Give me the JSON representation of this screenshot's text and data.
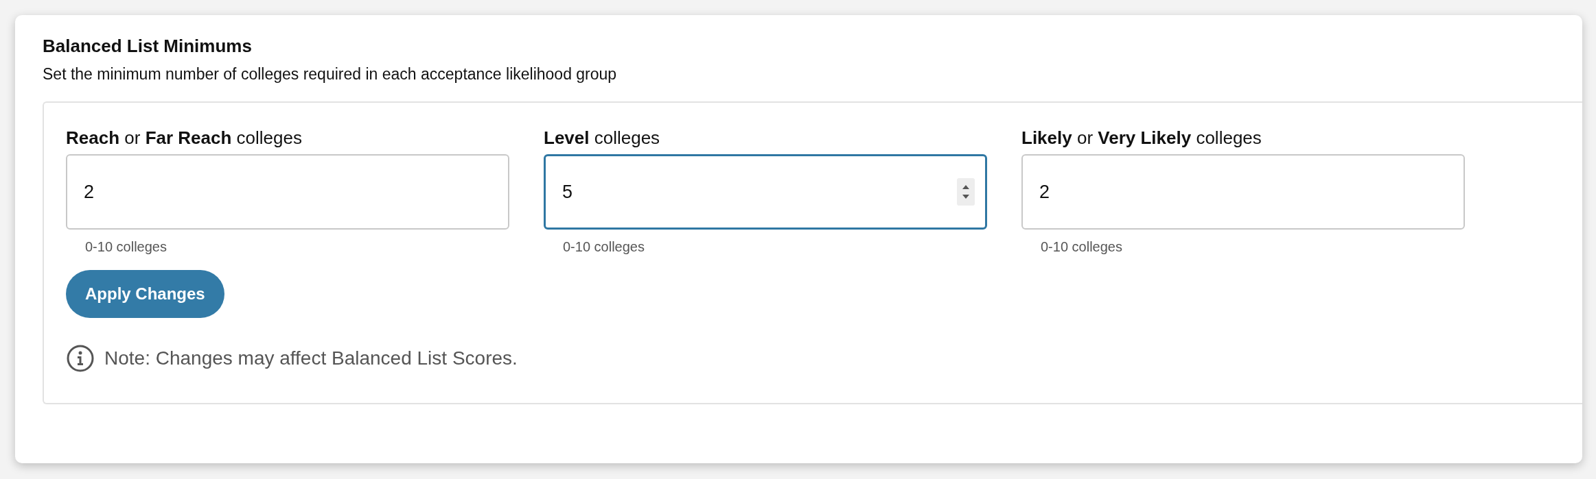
{
  "panel": {
    "title": "Balanced List Minimums",
    "description": "Set the minimum number of colleges required in each acceptance likelihood group",
    "fields": [
      {
        "label": "**Reach** or **Far Reach** colleges",
        "value": "2",
        "hint": "0-10 colleges",
        "focused": false
      },
      {
        "label": "**Level** colleges",
        "value": "5",
        "hint": "0-10 colleges",
        "focused": true
      },
      {
        "label": "**Likely** or **Very Likely** colleges",
        "value": "2",
        "hint": "0-10 colleges",
        "focused": false
      }
    ],
    "apply_button": "Apply Changes",
    "note": "Note: Changes may affect Balanced List Scores."
  }
}
